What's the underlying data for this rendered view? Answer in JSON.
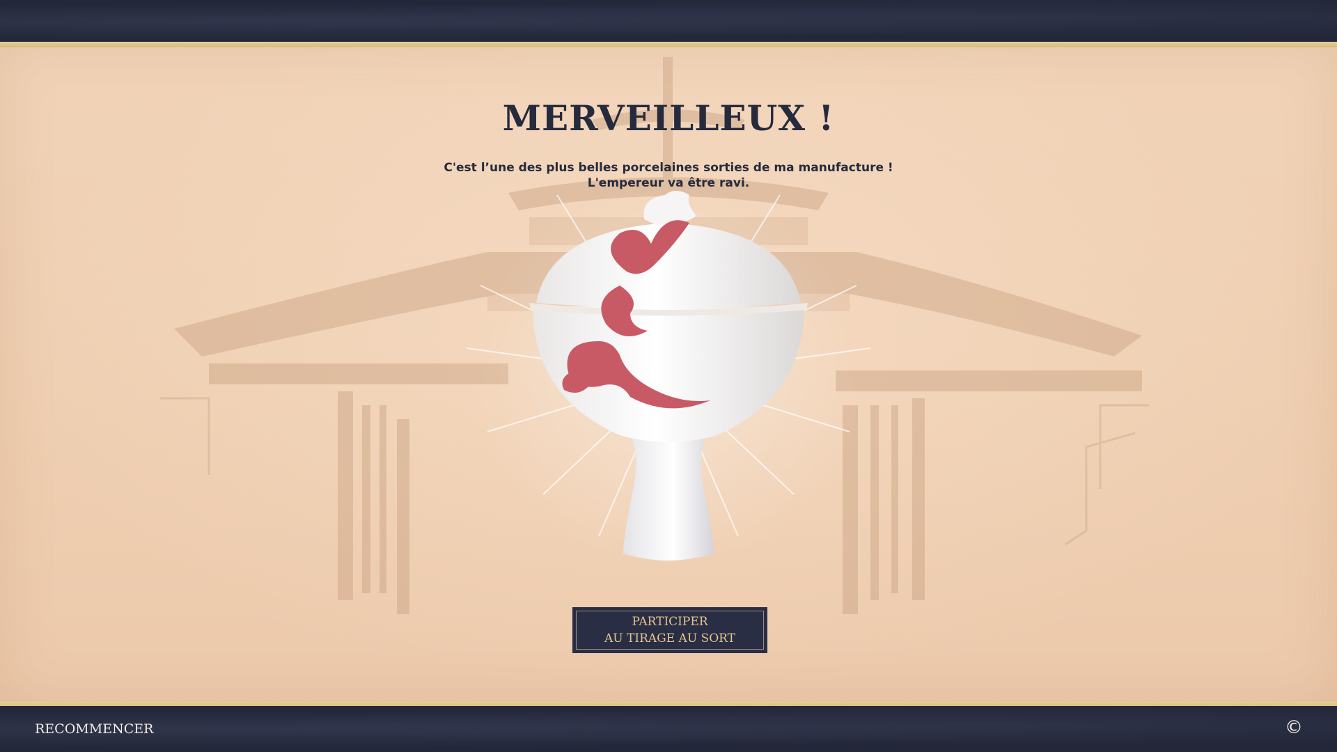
{
  "title": "MERVEILLEUX !",
  "message": {
    "line1": "C'est l’une des plus belles porcelaines sorties de ma manufacture !",
    "line2": "L'empereur va être ravi."
  },
  "cta": {
    "line1": "PARTICIPER",
    "line2": "AU TIRAGE AU SORT"
  },
  "footer": {
    "restart_label": "RECOMMENCER",
    "copyright_symbol": "©"
  },
  "icons": {
    "copyright": "copyright-icon"
  },
  "colors": {
    "frame": "#262a3d",
    "parchment": "#efcfb2",
    "title": "#262a3d",
    "button_bg": "#2a2e45",
    "button_text": "#e2c58f",
    "vase_motif": "#c85a66",
    "footer_text": "#f2eee6"
  }
}
